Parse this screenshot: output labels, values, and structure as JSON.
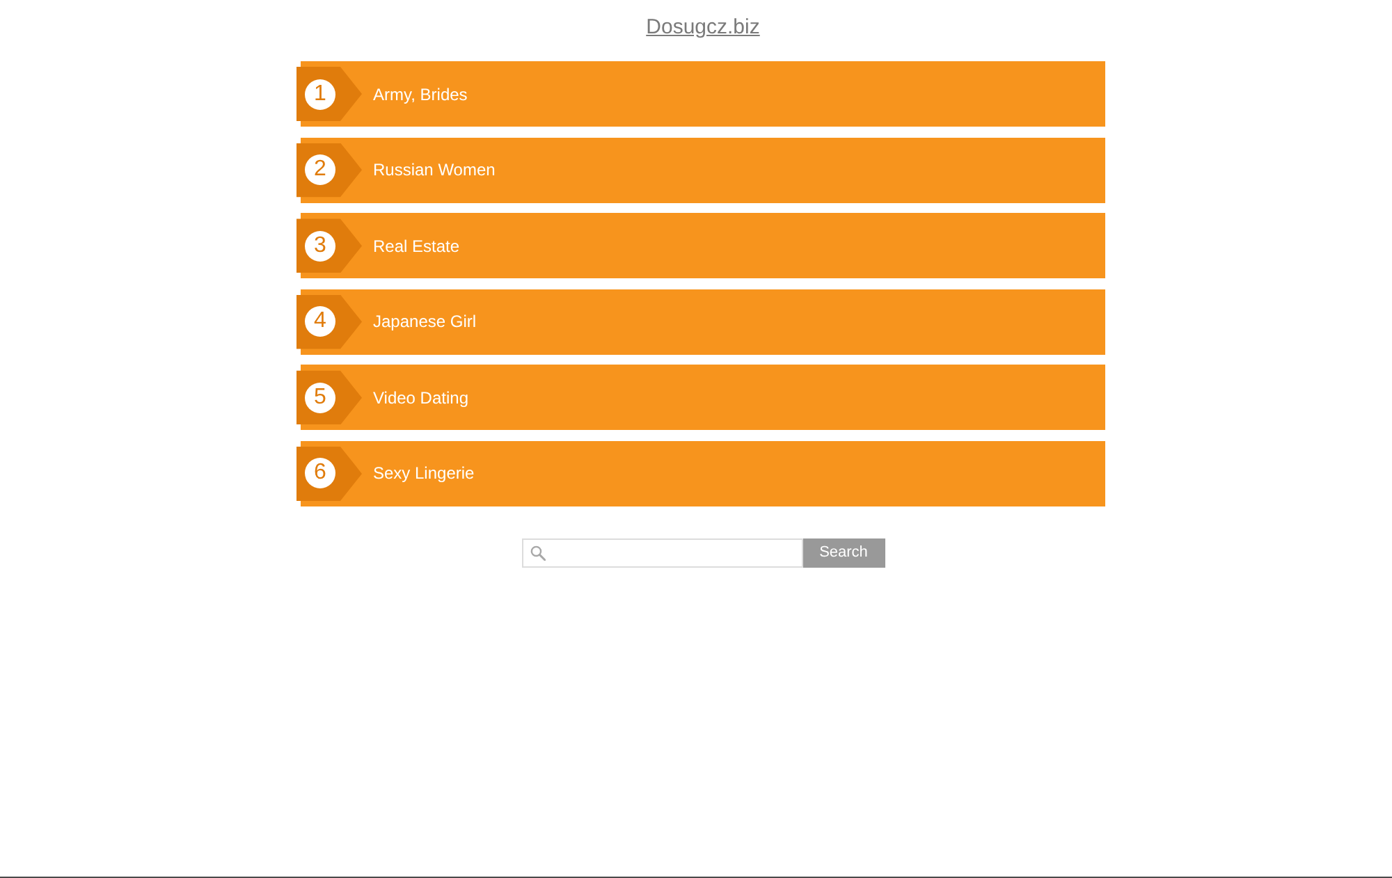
{
  "site_title": "Dosugcz.biz",
  "links": [
    {
      "number": "1",
      "label": "Army, Brides"
    },
    {
      "number": "2",
      "label": "Russian Women"
    },
    {
      "number": "3",
      "label": "Real Estate"
    },
    {
      "number": "4",
      "label": "Japanese Girl"
    },
    {
      "number": "5",
      "label": "Video Dating"
    },
    {
      "number": "6",
      "label": "Sexy Lingerie"
    }
  ],
  "search": {
    "button": "Search"
  }
}
